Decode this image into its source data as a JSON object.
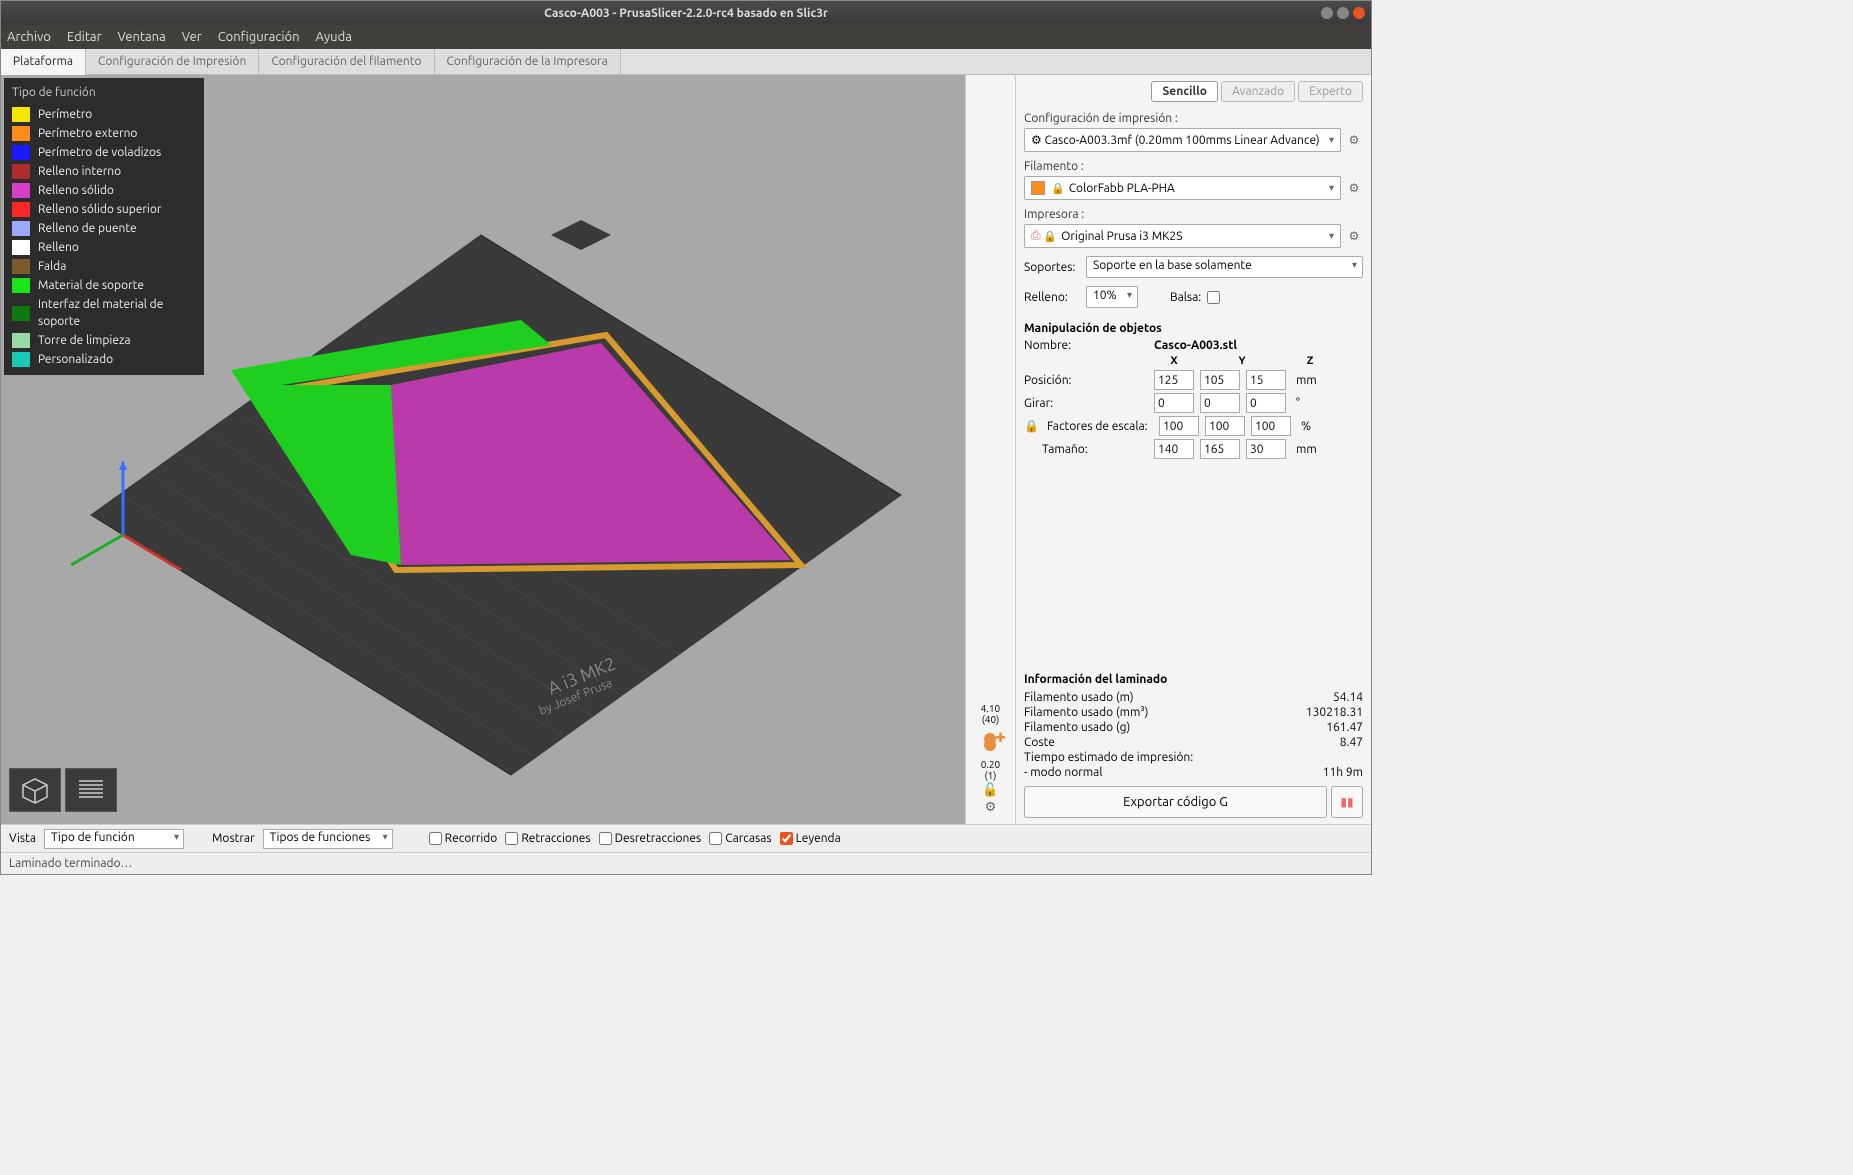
{
  "window": {
    "title": "Casco-A003 - PrusaSlicer-2.2.0-rc4 basado en Slic3r"
  },
  "menubar": [
    "Archivo",
    "Editar",
    "Ventana",
    "Ver",
    "Configuración",
    "Ayuda"
  ],
  "tabs": [
    "Plataforma",
    "Configuración de Impresión",
    "Configuración del filamento",
    "Configuración de la Impresora"
  ],
  "legend": {
    "title": "Tipo de función",
    "items": [
      {
        "c": "#f5e800",
        "t": "Perímetro"
      },
      {
        "c": "#ff8c1a",
        "t": "Perímetro externo"
      },
      {
        "c": "#1a1aff",
        "t": "Perímetro de voladizos"
      },
      {
        "c": "#b02b2b",
        "t": "Relleno interno"
      },
      {
        "c": "#d63fc6",
        "t": "Relleno sólido"
      },
      {
        "c": "#ff2626",
        "t": "Relleno sólido superior"
      },
      {
        "c": "#9da8ff",
        "t": "Relleno de puente"
      },
      {
        "c": "#ffffff",
        "t": "Relleno"
      },
      {
        "c": "#7a5b2e",
        "t": "Falda"
      },
      {
        "c": "#19e619",
        "t": "Material de soporte"
      },
      {
        "c": "#0d7a0d",
        "t": "Interfaz del material de soporte"
      },
      {
        "c": "#99d9a8",
        "t": "Torre de limpieza"
      },
      {
        "c": "#1ac9b5",
        "t": "Personalizado"
      }
    ]
  },
  "right": {
    "modes": [
      "Sencillo",
      "Avanzado",
      "Experto"
    ],
    "print_settings_label": "Configuración de impresión :",
    "print_settings_value": "Casco-A003.3mf (0.20mm 100mms Linear Advance)",
    "filament_label": "Filamento :",
    "filament_value": "ColorFabb PLA-PHA",
    "printer_label": "Impresora :",
    "printer_value": "Original Prusa i3 MK2S",
    "supports_label": "Soportes:",
    "supports_value": "Soporte en la base solamente",
    "infill_label": "Relleno:",
    "infill_value": "10%",
    "raft_label": "Balsa:",
    "obj_header": "Manipulación de objetos",
    "name_label": "Nombre:",
    "name_value": "Casco-A003.stl",
    "axes": {
      "x": "X",
      "y": "Y",
      "z": "Z"
    },
    "rows": {
      "position": {
        "label": "Posición:",
        "x": "125",
        "y": "105",
        "z": "15",
        "unit": "mm"
      },
      "rotate": {
        "label": "Girar:",
        "x": "0",
        "y": "0",
        "z": "0",
        "unit": "°"
      },
      "scale": {
        "label": "Factores de escala:",
        "x": "100",
        "y": "100",
        "z": "100",
        "unit": "%"
      },
      "size": {
        "label": "Tamaño:",
        "x": "140",
        "y": "165",
        "z": "30",
        "unit": "mm"
      }
    },
    "slider": {
      "top": "4.10",
      "top2": "(40)",
      "bot": "0.20",
      "bot2": "(1)"
    },
    "slice_info": {
      "title": "Información del laminado",
      "rows": [
        {
          "l": "Filamento usado (m)",
          "v": "54.14"
        },
        {
          "l": "Filamento usado (mm³)",
          "v": "130218.31"
        },
        {
          "l": "Filamento usado (g)",
          "v": "161.47"
        },
        {
          "l": "Coste",
          "v": "8.47"
        },
        {
          "l": "Tiempo estimado de impresión:",
          "v": ""
        },
        {
          "l": "  - modo normal",
          "v": "11h 9m"
        }
      ]
    },
    "export_label": "Exportar código G"
  },
  "bottom": {
    "vista": "Vista",
    "vista_value": "Tipo de función",
    "mostrar": "Mostrar",
    "mostrar_value": "Tipos de funciones",
    "cb": [
      "Recorrido",
      "Retracciones",
      "Desretracciones",
      "Carcasas",
      "Leyenda"
    ]
  },
  "status": "Laminado terminado…"
}
